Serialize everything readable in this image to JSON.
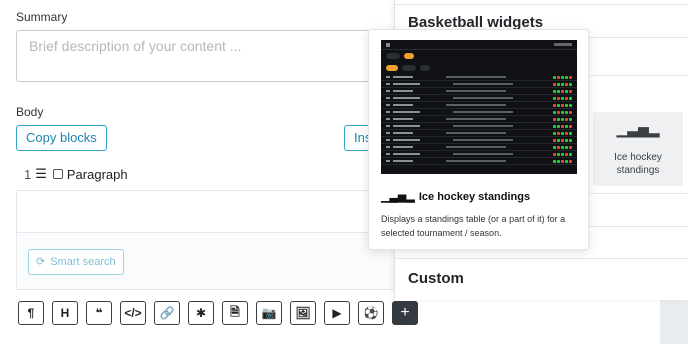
{
  "summary": {
    "label": "Summary",
    "placeholder": "Brief description of your content ..."
  },
  "body": {
    "label": "Body",
    "copy_blocks": "Copy blocks",
    "insert_partial": "Ins",
    "paragraph": {
      "number": "1",
      "handle_icon": "drag-handle-icon",
      "label": "Paragraph"
    },
    "smart_search": "Smart search"
  },
  "toolbar": [
    {
      "name": "paragraph-tool-button",
      "glyph": "¶"
    },
    {
      "name": "heading-tool-button",
      "glyph": "H"
    },
    {
      "name": "quote-tool-button",
      "glyph": "❝"
    },
    {
      "name": "code-tool-button",
      "glyph": "</>"
    },
    {
      "name": "link-tool-button",
      "glyph": "🔗"
    },
    {
      "name": "embed-tool-button",
      "glyph": "✱"
    },
    {
      "name": "document-tool-button",
      "glyph": "🗎"
    },
    {
      "name": "camera-tool-button",
      "glyph": "📷"
    },
    {
      "name": "image-tool-button",
      "glyph": "🖼"
    },
    {
      "name": "video-tool-button",
      "glyph": "▶"
    },
    {
      "name": "sports-tool-button",
      "glyph": "⚽"
    },
    {
      "name": "add-block-button",
      "glyph": "+"
    }
  ],
  "widget_panel": {
    "title": "Basketball widgets",
    "hockey_tile": {
      "icon": "bar-chart-icon",
      "label": "Ice hockey standings"
    },
    "custom_title": "Custom"
  },
  "popover": {
    "title": "Ice hockey standings",
    "description": "Displays a standings table (or a part of it) for a selected tournament / season.",
    "preview": {
      "tabs": [
        "",
        "",
        "",
        ""
      ]
    }
  },
  "colors": {
    "accent": "#31a3c6",
    "dark": "#343a40",
    "preview_bg": "#0f1115",
    "orange": "#f0a030"
  }
}
